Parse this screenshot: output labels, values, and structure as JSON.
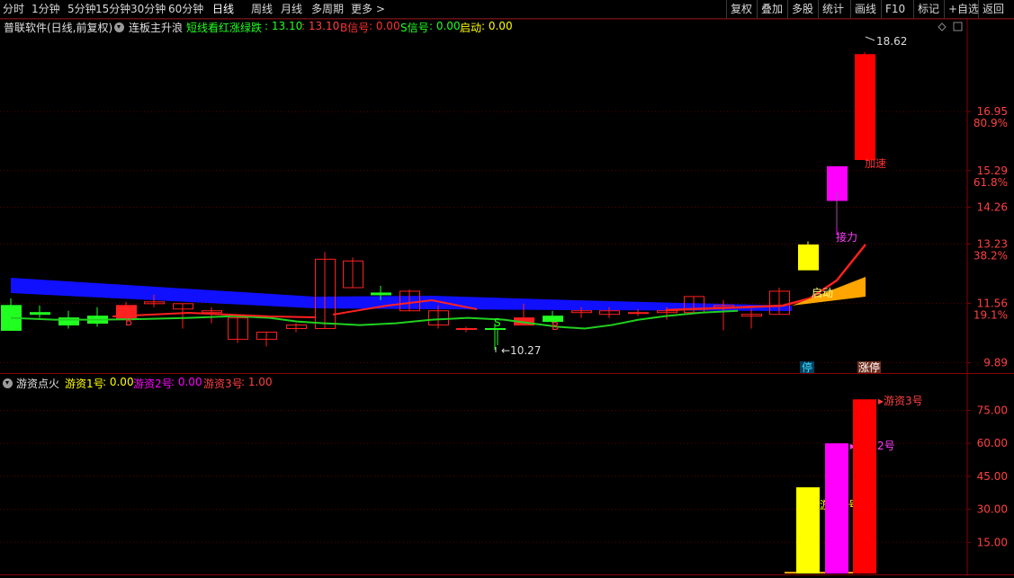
{
  "toolbar": {
    "left": [
      {
        "label": "分时"
      },
      {
        "label": "1分钟"
      },
      {
        "label": "5分钟"
      },
      {
        "label": "15分钟"
      },
      {
        "label": "30分钟"
      },
      {
        "label": "60分钟"
      },
      {
        "label": "日线",
        "active": true
      },
      {
        "label": "周线"
      },
      {
        "label": "月线"
      },
      {
        "label": "多周期"
      },
      {
        "label": "更多 >"
      }
    ],
    "right": [
      {
        "label": "复权"
      },
      {
        "label": "叠加"
      },
      {
        "label": "多股"
      },
      {
        "label": "统计"
      },
      {
        "label": "画线"
      },
      {
        "label": "F10"
      },
      {
        "label": "标记"
      },
      {
        "label": "+自选"
      },
      {
        "label": "返回"
      }
    ]
  },
  "main_panel": {
    "title": "普联软件(日线,前复权)",
    "indicator_name": "连板主升浪",
    "ind_text1": "短线看红涨绿跌",
    "ind_val1a": ": 13.10",
    "ind_val1b": ": 13.10",
    "b_label": "B信号",
    "b_val": ": 0.00",
    "s_label": "S信号",
    "s_val": ": 0.00",
    "qd_label": "启动",
    "qd_val": ": 0.00",
    "right_axis": [
      {
        "price": "16.95",
        "pct": "80.9%"
      },
      {
        "price": "15.29",
        "pct": "61.8%"
      },
      {
        "price": "14.26",
        "pct": ""
      },
      {
        "price": "13.23",
        "pct": "38.2%"
      },
      {
        "price": "11.56",
        "pct": "19.1%"
      },
      {
        "price": "9.89",
        "pct": ""
      }
    ],
    "high_label": "18.62",
    "low_label": "10.27",
    "marker_jiasu": "加速",
    "marker_jieli": "接力",
    "marker_qidong": "启动",
    "marker_B": "B",
    "marker_S": "S",
    "badge_ting": "停",
    "badge_zhangting": "涨停"
  },
  "sub_panel": {
    "title": "游资点火",
    "s1_label": "游资1号",
    "s1_val": ": 0.00",
    "s2_label": "游资2号",
    "s2_val": ": 0.00",
    "s3_label": "游资3号",
    "s3_val": ": 1.00",
    "right_axis": [
      "75.00",
      "60.00",
      "45.00",
      "30.00",
      "15.00"
    ],
    "bar_label1": "游资1号",
    "bar_label2": "游资2号",
    "bar_label3": "游资3号"
  },
  "colors": {
    "up": "#ff2020",
    "down": "#20ff20",
    "blue_band": "#1010ff",
    "yellow": "#ffff00",
    "magenta": "#ff00ff",
    "orange": "#ffa500",
    "axis": "#8b0000"
  },
  "chart_data": {
    "type": "candlestick",
    "candles": [
      {
        "o": 11.5,
        "h": 11.7,
        "c": 10.8,
        "l": 10.8
      },
      {
        "o": 11.3,
        "h": 11.5,
        "c": 11.25,
        "l": 11.15
      },
      {
        "o": 11.15,
        "h": 11.35,
        "c": 10.95,
        "l": 10.85
      },
      {
        "o": 11.0,
        "h": 11.45,
        "c": 11.2,
        "l": 10.9
      },
      {
        "o": 11.1,
        "h": 11.6,
        "c": 11.5,
        "l": 11.1
      },
      {
        "o": 11.55,
        "h": 11.8,
        "c": 11.6,
        "l": 11.45
      },
      {
        "o": 11.4,
        "h": 11.55,
        "c": 11.55,
        "l": 10.85
      },
      {
        "o": 11.3,
        "h": 11.45,
        "c": 11.35,
        "l": 11.0
      },
      {
        "o": 10.55,
        "h": 11.2,
        "c": 11.15,
        "l": 10.45
      },
      {
        "o": 10.55,
        "h": 10.75,
        "c": 10.75,
        "l": 10.35
      },
      {
        "o": 10.85,
        "h": 11.0,
        "c": 10.95,
        "l": 10.75
      },
      {
        "o": 10.85,
        "h": 13.0,
        "c": 12.8,
        "l": 10.85
      },
      {
        "o": 12.0,
        "h": 12.85,
        "c": 12.75,
        "l": 12.0
      },
      {
        "o": 11.85,
        "h": 12.05,
        "c": 11.8,
        "l": 11.65
      },
      {
        "o": 11.35,
        "h": 11.95,
        "c": 11.9,
        "l": 11.35
      },
      {
        "o": 10.95,
        "h": 11.5,
        "c": 11.35,
        "l": 10.85
      },
      {
        "o": 10.85,
        "h": 10.9,
        "c": 10.85,
        "l": 10.75
      },
      {
        "o": 10.85,
        "h": 11.0,
        "c": 10.85,
        "l": 10.25
      },
      {
        "o": 11.15,
        "h": 11.55,
        "c": 10.95,
        "l": 10.95
      },
      {
        "o": 11.2,
        "h": 11.35,
        "c": 11.05,
        "l": 11.0
      },
      {
        "o": 11.3,
        "h": 11.45,
        "c": 11.35,
        "l": 11.15
      },
      {
        "o": 11.25,
        "h": 11.45,
        "c": 11.35,
        "l": 11.15
      },
      {
        "o": 11.3,
        "h": 11.4,
        "c": 11.3,
        "l": 11.2
      },
      {
        "o": 11.3,
        "h": 11.45,
        "c": 11.35,
        "l": 11.1
      },
      {
        "o": 11.3,
        "h": 11.75,
        "c": 11.75,
        "l": 11.3
      },
      {
        "o": 11.45,
        "h": 11.65,
        "c": 11.5,
        "l": 10.8
      },
      {
        "o": 11.2,
        "h": 11.4,
        "c": 11.25,
        "l": 10.85
      },
      {
        "o": 11.25,
        "h": 12.0,
        "c": 11.9,
        "l": 11.25
      },
      {
        "o": 12.5,
        "h": 13.3,
        "c": 13.2,
        "l": 12.5
      },
      {
        "o": 14.45,
        "h": 15.4,
        "c": 15.4,
        "l": 13.5
      },
      {
        "o": 15.6,
        "h": 18.62,
        "c": 18.55,
        "l": 15.6
      }
    ],
    "line_red": [
      11.2,
      11.25,
      11.3,
      11.3,
      11.35,
      11.4,
      11.35,
      11.4,
      11.5,
      11.6,
      11.75,
      11.85,
      12.0,
      12.2,
      12.45,
      12.7
    ],
    "line_green": [
      11.15,
      11.1,
      11.1,
      11.12,
      11.15,
      11.2,
      11.15,
      11.05,
      11.0,
      10.95,
      11.0,
      11.1,
      11.15,
      11.1,
      11.0,
      10.9,
      10.85,
      10.95,
      11.1,
      11.2,
      11.3,
      11.35
    ],
    "sub_series": [
      {
        "name": "游资1号",
        "value": 40
      },
      {
        "name": "游资2号",
        "value": 60
      },
      {
        "name": "游资3号",
        "value": 80
      }
    ]
  }
}
